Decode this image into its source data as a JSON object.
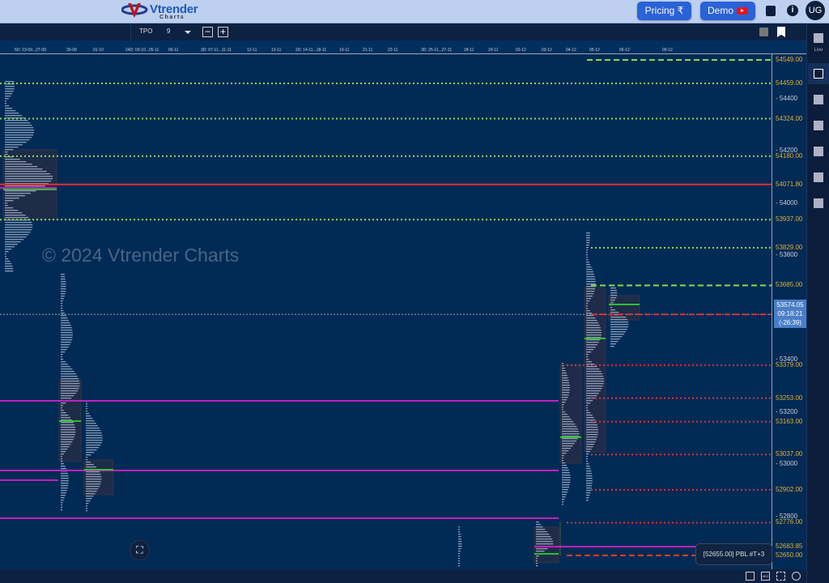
{
  "header": {
    "logo_main": "Vtrender",
    "logo_sub": "Charts",
    "pricing_label": "Pricing ₹",
    "demo_label": "Demo",
    "user_initials": "UG"
  },
  "toolbar": {
    "mode_label": "TPO",
    "mode_value": "9"
  },
  "sidebar": {
    "live_label": "Live",
    "icons": [
      "document-icon",
      "square-icon",
      "bars-icon",
      "lines-icon",
      "grid-icon",
      "columns-icon",
      "tiles-icon"
    ]
  },
  "dates": [
    "5D: 23-09...27-09",
    "30-09",
    "01-10",
    "24D: 03-10...05-11",
    "06-11",
    "3D: 07-11...11-11",
    "12-11",
    "13-11",
    "2D: 14-11...18-11",
    "19-11",
    "21-11",
    "22-11",
    "3D: 25-11...27-11",
    "28-11",
    "29-11",
    "02-12",
    "03-12",
    "04-12",
    "05-12",
    "06-12",
    "09-12"
  ],
  "price_axis": {
    "ticks": [
      "54400",
      "54200",
      "54000",
      "53800",
      "53400",
      "53200",
      "53000",
      "52800"
    ],
    "levels": [
      {
        "label": "54549.00",
        "price": 54549,
        "color": "#7ee04a",
        "style": "dashed"
      },
      {
        "label": "54459.00",
        "price": 54459,
        "color": "#7ee04a",
        "style": "dotted"
      },
      {
        "label": "54324.00",
        "price": 54324,
        "color": "#7ee04a",
        "style": "dotted"
      },
      {
        "label": "54180.00",
        "price": 54180,
        "color": "#7ee04a",
        "style": "dotted"
      },
      {
        "label": "54071.80",
        "price": 54071.8,
        "color": "#e03030",
        "style": "solid"
      },
      {
        "label": "53937.00",
        "price": 53937,
        "color": "#7ee04a",
        "style": "dotted"
      },
      {
        "label": "53829.00",
        "price": 53829,
        "color": "#7ee04a",
        "style": "dotted"
      },
      {
        "label": "53685.00",
        "price": 53685,
        "color": "#7ee04a",
        "style": "dashed"
      },
      {
        "label": "53379.00",
        "price": 53379,
        "color": "#e03030",
        "style": "dotted"
      },
      {
        "label": "53253.00",
        "price": 53253,
        "color": "#e03030",
        "style": "dotted"
      },
      {
        "label": "53163.00",
        "price": 53163,
        "color": "#e03030",
        "style": "dotted"
      },
      {
        "label": "53037.00",
        "price": 53037,
        "color": "#e03030",
        "style": "dotted"
      },
      {
        "label": "52902.00",
        "price": 52902,
        "color": "#e03030",
        "style": "dotted"
      },
      {
        "label": "52776.00",
        "price": 52776,
        "color": "#e03030",
        "style": "dotted"
      },
      {
        "label": "52683.85",
        "price": 52683.85,
        "color": "#c020c0",
        "style": "solid"
      },
      {
        "label": "52650.00",
        "price": 52650,
        "color": "#e04020",
        "style": "dashed"
      }
    ]
  },
  "cursor": {
    "price": "53574.05",
    "time": "09:18:21",
    "countdown": "(-26:39)"
  },
  "watermark": "© 2024 Vtrender Charts",
  "tooltip": "[52655.00] PBL #T+3",
  "colors": {
    "background": "#012a55",
    "level_label": "#e0b030",
    "green": "#7ee04a",
    "red": "#e03030",
    "magenta": "#c020c0"
  }
}
